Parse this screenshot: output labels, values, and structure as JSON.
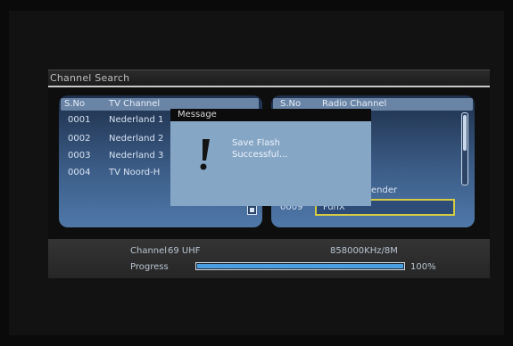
{
  "window": {
    "title": "Channel Search"
  },
  "tv_list": {
    "header_sno": "S.No",
    "header_name": "TV Channel",
    "rows": [
      {
        "no": "0001",
        "name": "Nederland 1"
      },
      {
        "no": "0002",
        "name": "Nederland 2"
      },
      {
        "no": "0003",
        "name": "Nederland 3"
      },
      {
        "no": "0004",
        "name": "TV Noord-H"
      }
    ]
  },
  "radio_list": {
    "header_sno": "S.No",
    "header_name": "Radio Channel",
    "rows": [
      {
        "no": "",
        "name": "ender"
      },
      {
        "no": "0009",
        "name": "FunX"
      }
    ]
  },
  "dialog": {
    "title": "Message",
    "line1": "Save Flash",
    "line2": "Successful..."
  },
  "status": {
    "channel_label": "Channel",
    "channel_value": "69 UHF",
    "frequency": "858000KHz/8M",
    "progress_label": "Progress",
    "progress_percent_text": "100%",
    "progress_value": 1.0
  },
  "colors": {
    "panel_blue": "#3b5c86",
    "dialog_blue": "#86a6c6",
    "selection_yellow": "#d6cc44",
    "progress_blue": "#4a9ee0"
  }
}
